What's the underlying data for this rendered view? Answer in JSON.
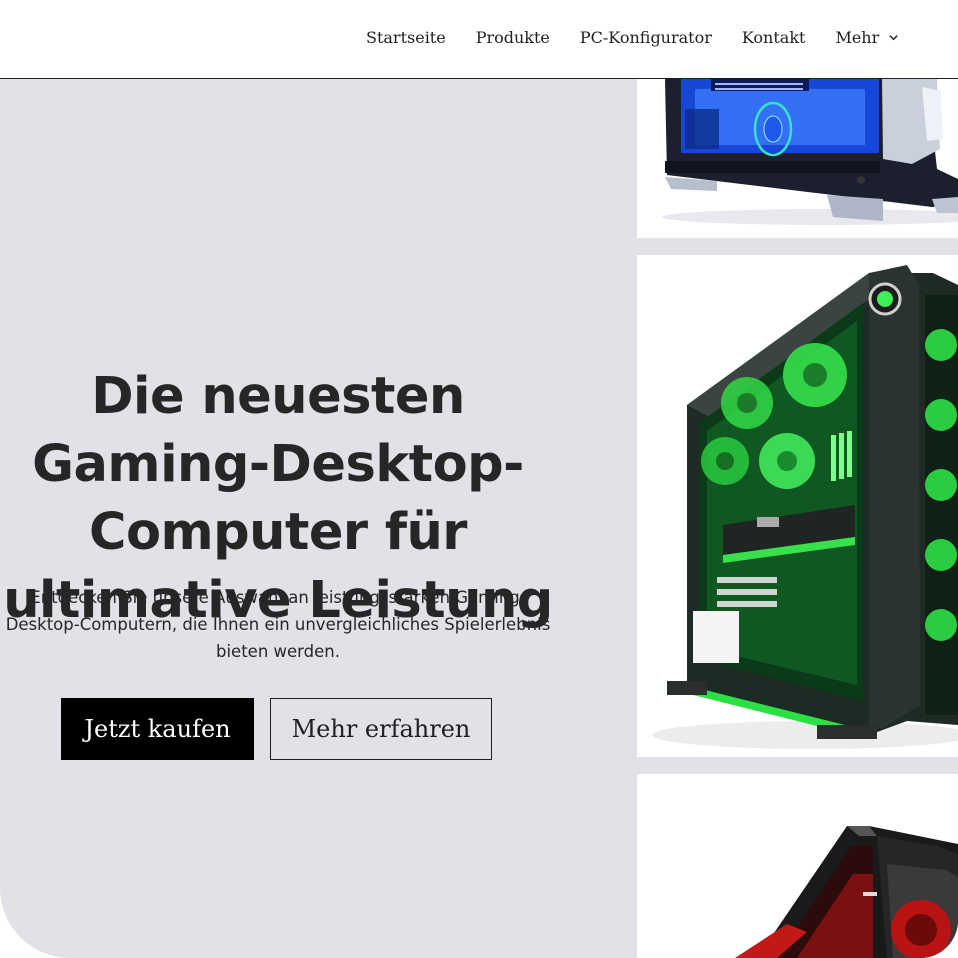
{
  "nav": {
    "items": [
      "Startseite",
      "Produkte",
      "PC-Konfigurator",
      "Kontakt"
    ],
    "more_label": "Mehr"
  },
  "hero": {
    "title": "Die neuesten Gaming-Desktop-Computer für ultimative Leistung",
    "subtitle": "Entdecken Sie unsere Auswahl an leistungsstarken Gaming-Desktop-Computern, die Ihnen ein unvergleichliches Spielerlebnis bieten werden.",
    "primary_button": "Jetzt kaufen",
    "secondary_button": "Mehr erfahren"
  },
  "colors": {
    "hero_background": "#e1e1e7",
    "text": "#262626",
    "primary_button_bg": "#000000",
    "primary_button_text": "#ffffff",
    "pc_blue_accent": "#2f6bff",
    "pc_green_accent": "#22d63a",
    "pc_red_accent": "#c21818"
  },
  "images": [
    {
      "name": "gaming-pc-blue"
    },
    {
      "name": "gaming-pc-green"
    },
    {
      "name": "gaming-pc-red"
    }
  ]
}
